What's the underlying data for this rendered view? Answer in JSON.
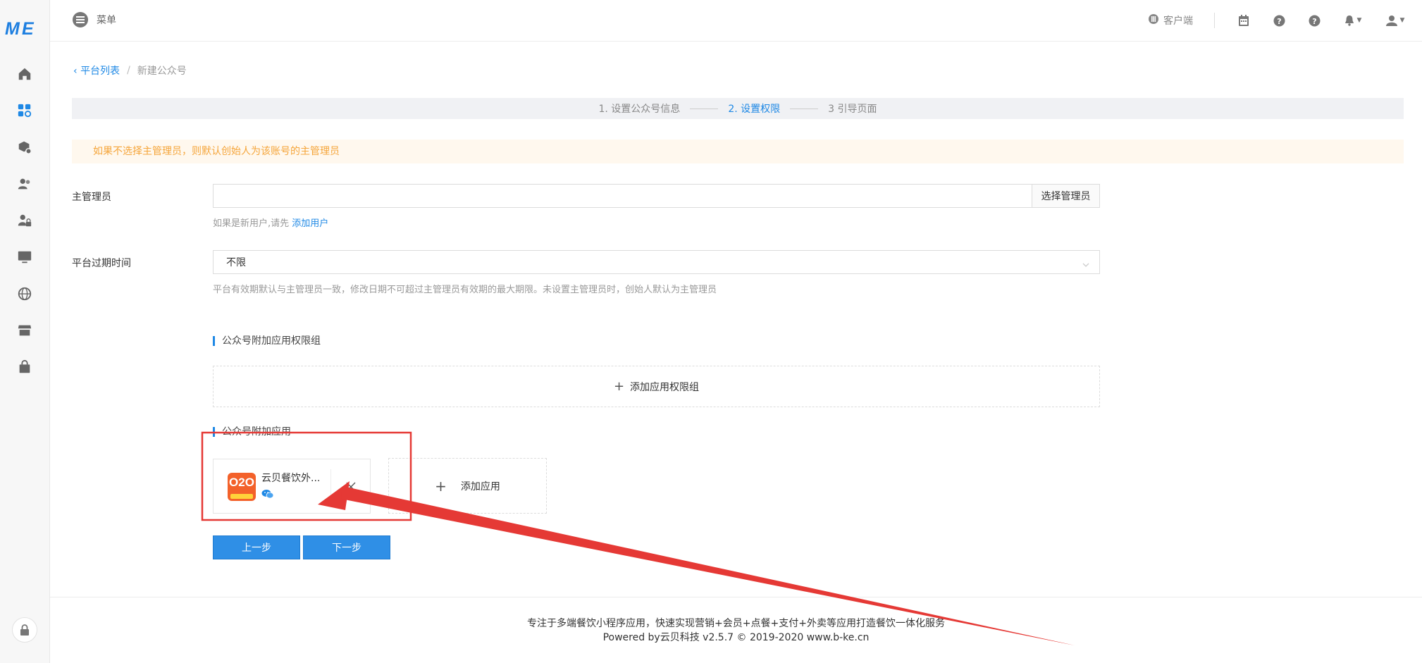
{
  "header": {
    "menu_label": "菜单",
    "client_label": "客户端"
  },
  "breadcrumb": {
    "back_label": "平台列表",
    "separator": "/",
    "current": "新建公众号"
  },
  "steps": [
    {
      "label": "1. 设置公众号信息",
      "active": false
    },
    {
      "label": "2. 设置权限",
      "active": true
    },
    {
      "label": "3 引导页面",
      "active": false
    }
  ],
  "alert": "如果不选择主管理员，则默认创始人为该账号的主管理员",
  "admin": {
    "label": "主管理员",
    "value": "",
    "pick_button": "选择管理员",
    "hint_prefix": "如果是新用户,请先",
    "hint_link": "添加用户"
  },
  "expire": {
    "label": "平台过期时间",
    "value": "不限",
    "hint": "平台有效期默认与主管理员一致，修改日期不可超过主管理员有效期的最大期限。未设置主管理员时，创始人默认为主管理员"
  },
  "perm_group": {
    "title": "公众号附加应用权限组",
    "add_label": "添加应用权限组"
  },
  "apps": {
    "title": "公众号附加应用",
    "items": [
      {
        "name": "云贝餐饮外...",
        "logo_text": "O2O",
        "logo_color": "#f3612a"
      }
    ],
    "add_label": "添加应用"
  },
  "buttons": {
    "prev": "上一步",
    "next": "下一步"
  },
  "footer": {
    "line1": "专注于多端餐饮小程序应用，快速实现营销+会员+点餐+支付+外卖等应用打造餐饮一体化服务",
    "line2": "Powered by云贝科技 v2.5.7 © 2019-2020 www.b-ke.cn"
  },
  "colors": {
    "accent": "#1e88e5",
    "warning": "#f5a53a",
    "annotation": "#e53935"
  }
}
